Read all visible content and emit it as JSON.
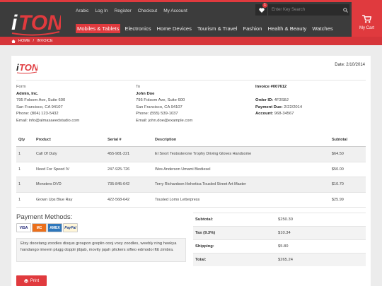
{
  "header": {
    "toplinks": [
      "Arabic",
      "Log In",
      "Register",
      "Checkout",
      "My Account"
    ],
    "search_placeholder": "Enter Key Search",
    "wishlist_count": "1",
    "nav": [
      "Mobiles & Tablets",
      "Electronics",
      "Home Devices",
      "Tourism & Travel",
      "Fashion",
      "Health & Beauty",
      "Watches"
    ],
    "cart_label": "My Cart"
  },
  "breadcrumb": {
    "home": "HOME",
    "sep": "/",
    "current": "INVOICE"
  },
  "invoice": {
    "date": "Date: 2/10/2014",
    "from": {
      "label": "Form",
      "name": "Admin, Inc.",
      "address1": "795 Folsom Ave, Suite 600",
      "address2": "San Francisco, CA 94107",
      "phone": "Phone: (804) 123-5432",
      "email": "Email: info@almasaeedstudio.com"
    },
    "to": {
      "label": "To",
      "name": "John Doe",
      "address1": "795 Folsom Ave, Suite 600",
      "address2": "San Francisco, CA 94107",
      "phone": "Phone: (555) 539-1037",
      "email": "Email: john.doe@example.com"
    },
    "meta": {
      "number": "Invoice #007612",
      "order_label": "Order ID:",
      "order_value": "4F3S8J",
      "due_label": "Payment Due:",
      "due_value": "2/22/2014",
      "account_label": "Account:",
      "account_value": "968-34567"
    },
    "table": {
      "headers": [
        "Qty",
        "Product",
        "Serial #",
        "Description",
        "Subtotal"
      ],
      "rows": [
        [
          "1",
          "Call Of Duty",
          "455-981-221",
          "El Snort Testosterone Trophy Driving Gloves Handsome",
          "$64.50"
        ],
        [
          "1",
          "Need For Speed IV",
          "247-925-726",
          "Wes Anderson Umami Biodiesel",
          "$50.00"
        ],
        [
          "1",
          "Monsters DVD",
          "735-845-642",
          "Terry Richardson Helvetica Tousled Street Art Master",
          "$10.70"
        ],
        [
          "1",
          "Grown Ups Blue Ray",
          "422-568-642",
          "Tousled Lomo Letterpress",
          "$25.99"
        ]
      ]
    },
    "payment": {
      "title": "Payment Methods:",
      "cards": [
        "VISA",
        "MC",
        "AMEX",
        "PayPal"
      ],
      "note": "Etsy doostang zoodles disqus groupon greplin oooj voxy zoodles, weebly ning heekya handango imeem plugg dopplr jibjab, movity jajah plickers sifteo edmodo ifttt zimbra."
    },
    "totals": [
      {
        "label": "Subtotal:",
        "value": "$250.30"
      },
      {
        "label": "Tax (9.3%)",
        "value": "$10.34"
      },
      {
        "label": "Shipping:",
        "value": "$5.80"
      },
      {
        "label": "Total:",
        "value": "$265.24"
      }
    ],
    "print_label": "Print"
  },
  "colors": {
    "brand": "#e03a3e",
    "header_bg": "#3c3c3c"
  }
}
